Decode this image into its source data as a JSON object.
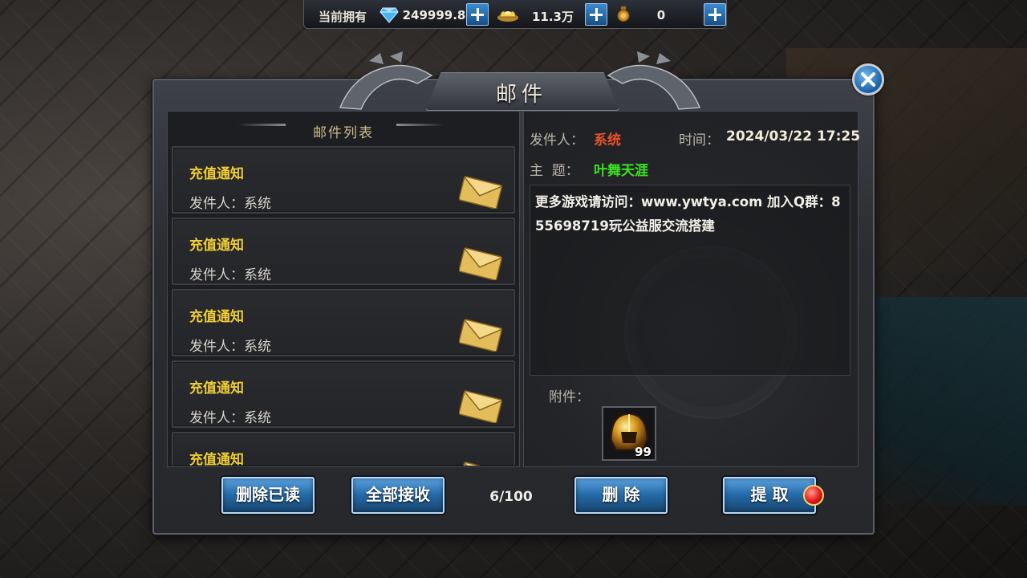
{
  "currency_bar": {
    "label": "当前拥有",
    "items": [
      {
        "icon": "diamond-icon",
        "value": "249999.8"
      },
      {
        "icon": "gold-ingot-icon",
        "value": "11.3万"
      },
      {
        "icon": "medal-icon",
        "value": "0"
      }
    ]
  },
  "panel": {
    "title": "邮件"
  },
  "mail_list": {
    "header": "邮件列表",
    "items": [
      {
        "subject": "充值通知",
        "sender": "发件人：系统"
      },
      {
        "subject": "充值通知",
        "sender": "发件人：系统"
      },
      {
        "subject": "充值通知",
        "sender": "发件人：系统"
      },
      {
        "subject": "充值通知",
        "sender": "发件人：系统"
      },
      {
        "subject": "充值通知",
        "sender": ""
      }
    ]
  },
  "detail": {
    "sender_label": "发件人：",
    "sender_value": "系统",
    "time_label": "时间：",
    "time_value": "2024/03/22 17:25",
    "subject_label": "主  题：",
    "subject_value": "叶舞天涯",
    "content": "更多游戏请访问：www.ywtya.com  加入Q群：855698719玩公益服交流搭建",
    "attachment_label": "附件：",
    "attachment_count": "99"
  },
  "actions": {
    "delete_read": "删除已读",
    "receive_all": "全部接收",
    "mail_count": "6/100",
    "delete": "删 除",
    "claim": "提 取"
  },
  "colors": {
    "subject_yellow": "#f0cd34",
    "sender_red": "#e8502a",
    "subject_green": "#3be022",
    "button_blue": "#256aa8"
  }
}
